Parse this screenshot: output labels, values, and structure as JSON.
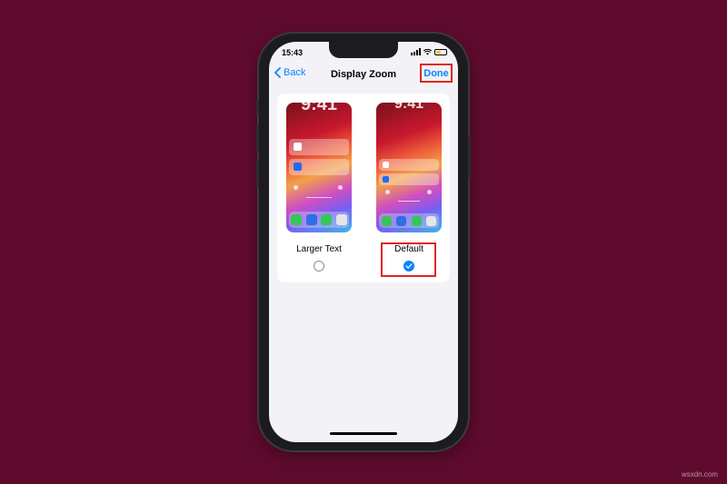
{
  "status_bar": {
    "time": "15:43"
  },
  "nav": {
    "back_label": "Back",
    "title": "Display Zoom",
    "done_label": "Done"
  },
  "options": [
    {
      "label": "Larger Text",
      "selected": false,
      "preview_time": "9:41"
    },
    {
      "label": "Default",
      "selected": true,
      "preview_time": "9:41"
    }
  ],
  "watermark": "wsxdn.com",
  "colors": {
    "background": "#5e0b2e",
    "accent": "#0a84ff",
    "highlight": "#e0281f"
  }
}
